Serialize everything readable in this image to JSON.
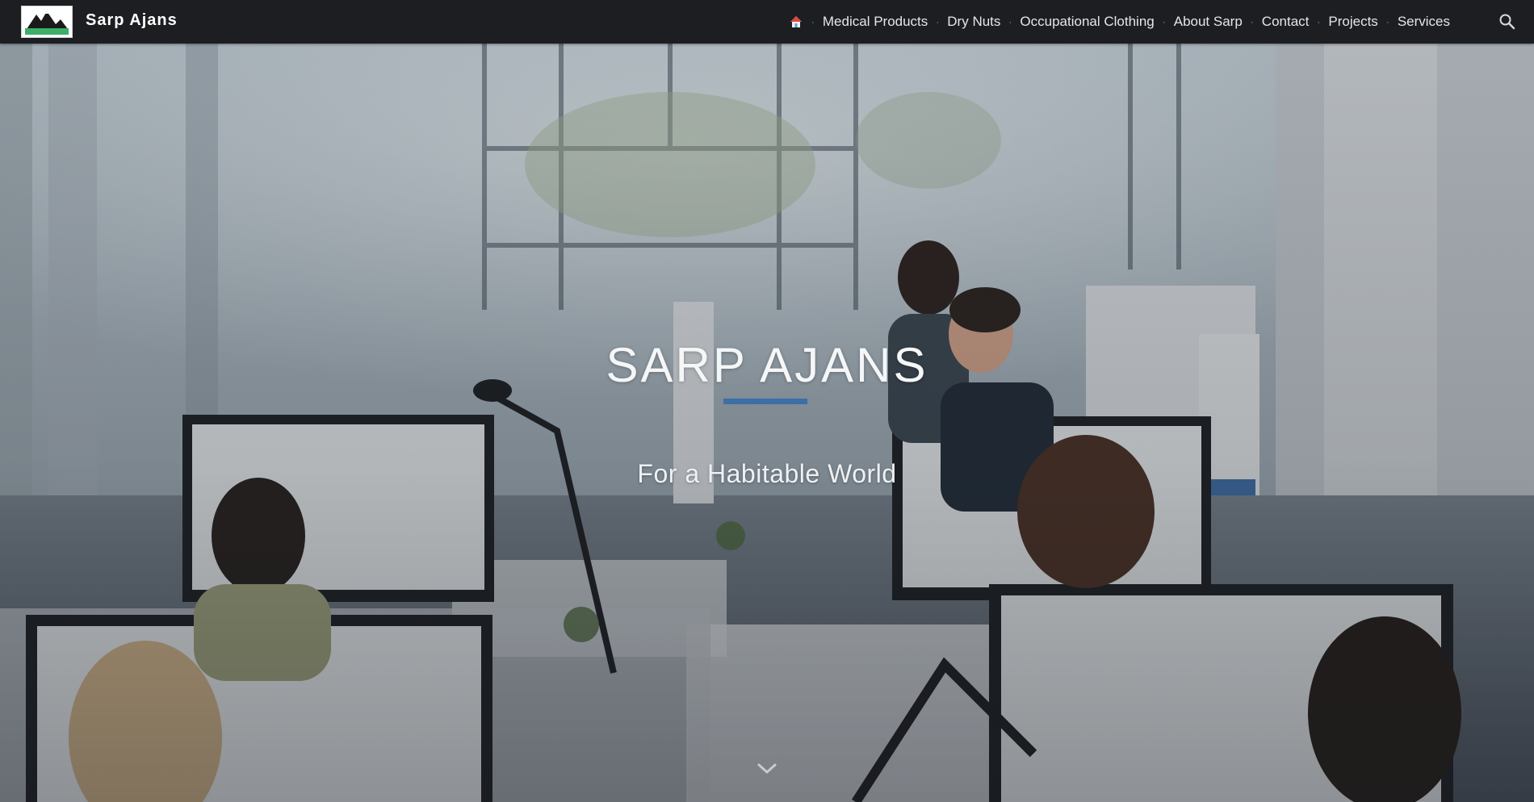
{
  "header": {
    "site_title": "Sarp Ajans",
    "logo_icon": "mountain-logo-icon",
    "home_icon": "home-icon",
    "search_icon": "search-icon",
    "nav": [
      {
        "label": "Medical Products"
      },
      {
        "label": "Dry Nuts"
      },
      {
        "label": "Occupational Clothing"
      },
      {
        "label": "About Sarp"
      },
      {
        "label": "Contact"
      },
      {
        "label": "Projects"
      },
      {
        "label": "Services"
      }
    ]
  },
  "hero": {
    "title": "SARP AJANS",
    "subtitle": "For a Habitable World",
    "scroll_icon": "chevron-down-icon",
    "accent_color": "#3b6fa6"
  }
}
